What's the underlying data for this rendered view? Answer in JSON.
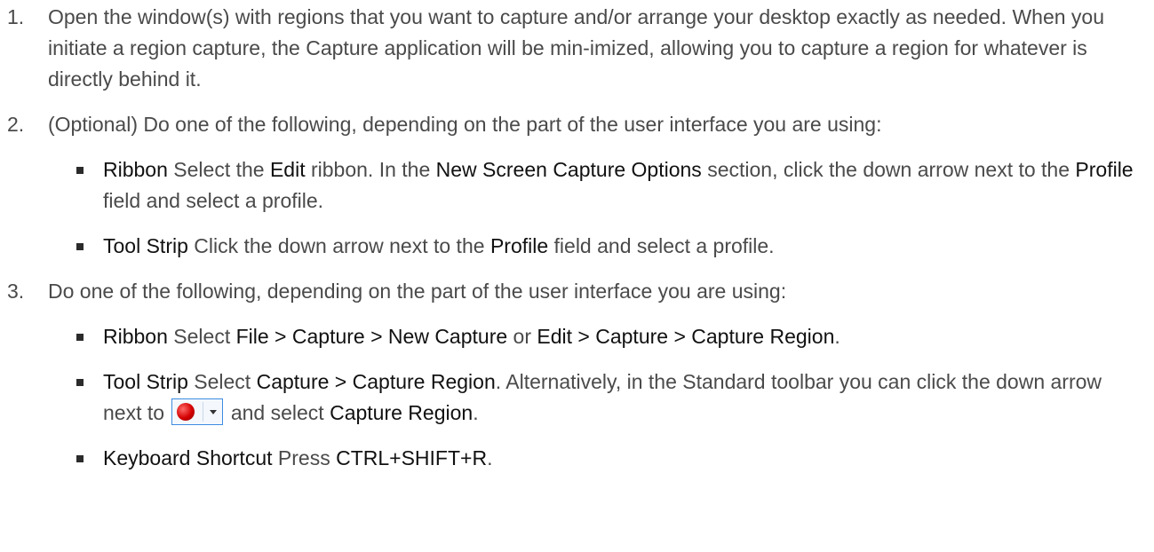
{
  "steps": [
    {
      "number": "1.",
      "text": "Open the window(s) with regions that you want to capture and/or arrange your desktop exactly as needed. When you initiate a region capture, the Capture application will be min-imized, allowing you to capture a region for whatever is directly behind it."
    },
    {
      "number": "2.",
      "text": "(Optional) Do one of the following, depending on the part of the user interface you are using:",
      "bullets": [
        {
          "lead": "Ribbon",
          "t1": " Select the ",
          "b1": "Edit",
          "t2": " ribbon. In the ",
          "b2": "New Screen Capture Options",
          "t3": " section, click the down arrow next to the ",
          "b3": "Profile",
          "t4": " field and select a profile."
        },
        {
          "lead": "Tool Strip",
          "t1": " Click the down arrow next to the ",
          "b1": "Profile",
          "t2": " field and select a profile."
        }
      ]
    },
    {
      "number": "3.",
      "text": "Do one of the following, depending on the part of the user interface you are using:",
      "bullets": [
        {
          "lead": "Ribbon",
          "t1": " Select ",
          "b1": "File > Capture > New Capture",
          "t2": " or ",
          "b2": "Edit > Capture > Capture Region",
          "t3": "."
        },
        {
          "lead": "Tool Strip",
          "t1": " Select ",
          "b1": "Capture > Capture Region",
          "t2": ". Alternatively, in the Standard toolbar you can click the down arrow next to ",
          "icon": "record-dropdown-icon",
          "t3": " and select ",
          "b2": "Capture Region",
          "t4": "."
        },
        {
          "lead": "Keyboard Shortcut",
          "t1": " Press ",
          "b1": "CTRL+SHIFT+R",
          "t2": "."
        }
      ]
    }
  ]
}
